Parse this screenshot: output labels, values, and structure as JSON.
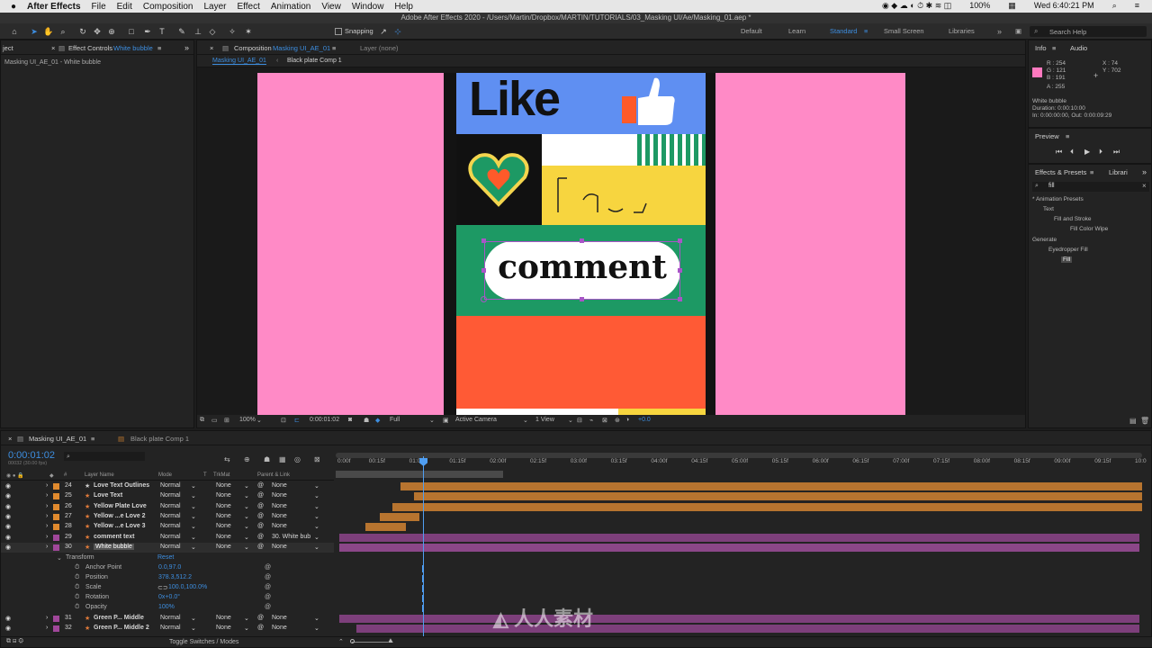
{
  "menubar": {
    "app": "After Effects",
    "items": [
      "File",
      "Edit",
      "Composition",
      "Layer",
      "Effect",
      "Animation",
      "View",
      "Window",
      "Help"
    ],
    "battery": "100%",
    "clock": "Wed 6:40:21 PM"
  },
  "window_title": "Adobe After Effects 2020 - /Users/Martin/Dropbox/MARTIN/TUTORIALS/03_Masking UI/Ae/Masking_01.aep *",
  "toolbar": {
    "snapping": "Snapping",
    "workspaces": [
      "Default",
      "Learn",
      "Standard",
      "Small Screen",
      "Libraries"
    ],
    "active_workspace": "Standard",
    "search_help": "Search Help"
  },
  "effect_controls": {
    "tab_left": "ject",
    "tab": "Effect Controls",
    "tab_layer": "White bubble",
    "subtitle": "Masking UI_AE_01 - White bubble"
  },
  "composition": {
    "tab": "Composition",
    "tab_name": "Masking UI_AE_01",
    "layer_tab": "Layer (none)",
    "flow": [
      "Masking UI_AE_01",
      "Black plate Comp 1"
    ],
    "artwork": {
      "like": "Like",
      "comment": "comment"
    },
    "footer": {
      "zoom": "100%",
      "time": "0:00:01:02",
      "quality": "Full",
      "camera": "Active Camera",
      "view": "1 View",
      "exposure": "+0.0"
    }
  },
  "info": {
    "tab": "Info",
    "tab2": "Audio",
    "r": "R : 254",
    "g": "G : 121",
    "b": "B : 191",
    "a": "A : 255",
    "x": "X : 74",
    "y": "Y : 702",
    "swatch": "#fe79bf",
    "layer": "White bubble",
    "duration": "Duration: 0:00:10:00",
    "inout": "In: 0:00:00:00, Out: 0:00:09:29"
  },
  "preview": {
    "title": "Preview"
  },
  "effects": {
    "tab": "Effects & Presets",
    "tab2": "Librari",
    "search": "fill",
    "tree": [
      "* Animation Presets",
      "Text",
      "Fill and Stroke",
      "Fill Color Wipe",
      "Generate",
      "Eyedropper Fill",
      "Fill"
    ]
  },
  "timeline": {
    "tabs": [
      "Masking UI_AE_01",
      "Black plate Comp 1"
    ],
    "timecode": "0:00:01:02",
    "frames": "00032 (30.00 fps)",
    "headers": {
      "num": "#",
      "name": "Layer Name",
      "mode": "Mode",
      "t": "T",
      "trkmat": "TrkMat",
      "parent": "Parent & Link"
    },
    "ruler": [
      "0:00f",
      "00:15f",
      "01:00f",
      "01:15f",
      "02:00f",
      "02:15f",
      "03:00f",
      "03:15f",
      "04:00f",
      "04:15f",
      "05:00f",
      "05:15f",
      "06:00f",
      "06:15f",
      "07:00f",
      "07:15f",
      "08:00f",
      "08:15f",
      "09:00f",
      "09:15f",
      "10:0"
    ],
    "layers": [
      {
        "num": "24",
        "name": "Love Text Outlines",
        "mode": "Normal",
        "trkmat": "None",
        "parent": "None",
        "color": "#e08a2e",
        "bar_color": "#b7742f",
        "start": 0.08,
        "end": 1.0
      },
      {
        "num": "25",
        "name": "Love Text",
        "mode": "Normal",
        "trkmat": "None",
        "parent": "None",
        "color": "#e08a2e",
        "bar_color": "#b7742f",
        "start": 0.097,
        "end": 1.0
      },
      {
        "num": "26",
        "name": "Yellow Plate Love",
        "mode": "Normal",
        "trkmat": "None",
        "parent": "None",
        "color": "#e08a2e",
        "bar_color": "#b7742f",
        "start": 0.07,
        "end": 1.0
      },
      {
        "num": "27",
        "name": "Yellow ...e Love 2",
        "mode": "Normal",
        "trkmat": "None",
        "parent": "None",
        "color": "#e08a2e",
        "bar_color": "#b7742f",
        "start": 0.055,
        "end": 0.104
      },
      {
        "num": "28",
        "name": "Yellow ...e Love 3",
        "mode": "Normal",
        "trkmat": "None",
        "parent": "None",
        "color": "#e08a2e",
        "bar_color": "#b7742f",
        "start": 0.037,
        "end": 0.087
      },
      {
        "num": "29",
        "name": "comment text",
        "mode": "Normal",
        "trkmat": "None",
        "parent": "30. White bub",
        "color": "#a0479a",
        "bar_color": "#7d3f7b",
        "start": 0.004,
        "end": 0.997
      },
      {
        "num": "30",
        "name": "White bubble",
        "mode": "Normal",
        "trkmat": "None",
        "parent": "None",
        "color": "#a0479a",
        "bar_color": "#8b4788",
        "start": 0.004,
        "end": 0.997,
        "selected": true
      },
      {
        "num": "31",
        "name": "Green P... Middle",
        "mode": "Normal",
        "trkmat": "None",
        "parent": "None",
        "color": "#a0479a",
        "bar_color": "#7d3f7b",
        "start": 0.004,
        "end": 0.997
      },
      {
        "num": "32",
        "name": "Green P... Middle 2",
        "mode": "Normal",
        "trkmat": "None",
        "parent": "None",
        "color": "#a0479a",
        "bar_color": "#7d3f7b",
        "start": 0.026,
        "end": 0.997
      }
    ],
    "transform": {
      "label": "Transform",
      "reset": "Reset",
      "props": [
        {
          "name": "Anchor Point",
          "value": "0.0,97.0"
        },
        {
          "name": "Position",
          "value": "378.3,512.2"
        },
        {
          "name": "Scale",
          "value": "100.0,100.0%"
        },
        {
          "name": "Rotation",
          "value": "0x+0.0°"
        },
        {
          "name": "Opacity",
          "value": "100%"
        }
      ]
    },
    "footer": "Toggle Switches / Modes",
    "playhead_fraction": 0.104
  },
  "watermark": "人人素材"
}
